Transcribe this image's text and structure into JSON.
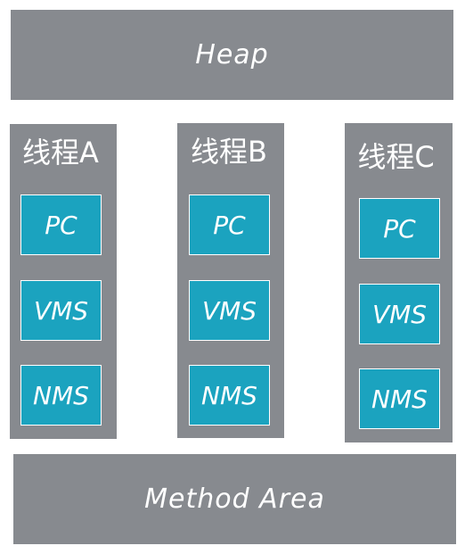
{
  "heap": {
    "label": "Heap"
  },
  "method_area": {
    "label": "Method Area"
  },
  "threads": [
    {
      "title": "线程A",
      "boxes": [
        "PC",
        "VMS",
        "NMS"
      ]
    },
    {
      "title": "线程B",
      "boxes": [
        "PC",
        "VMS",
        "NMS"
      ]
    },
    {
      "title": "线程C",
      "boxes": [
        "PC",
        "VMS",
        "NMS"
      ]
    }
  ],
  "colors": {
    "panel": "#878a8f",
    "box": "#1ba3bf",
    "text": "#ffffff"
  }
}
